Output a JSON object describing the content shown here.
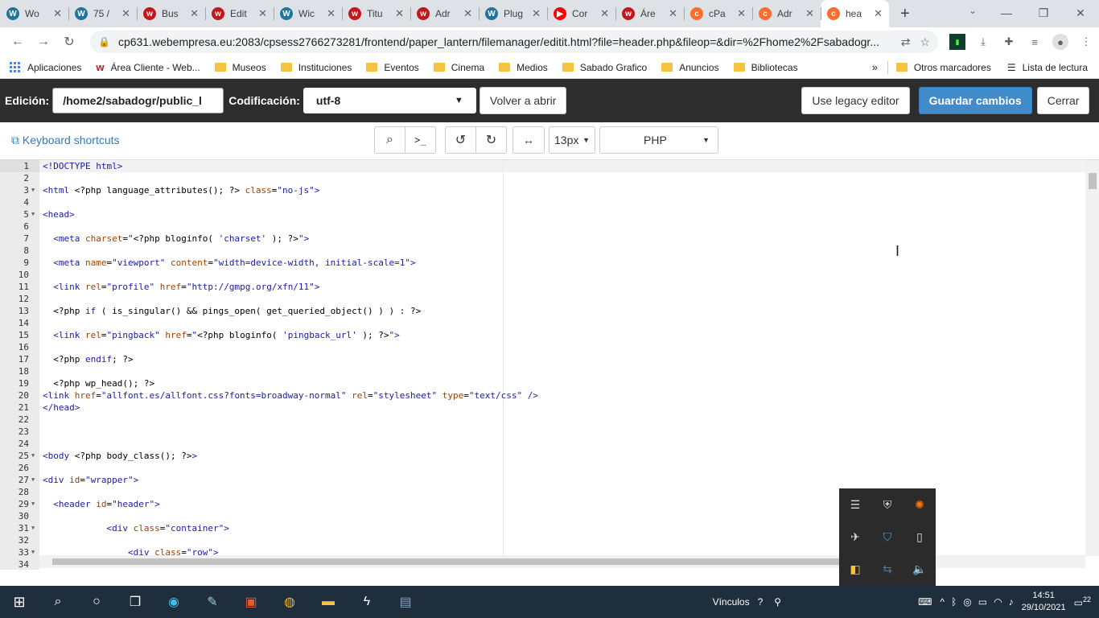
{
  "tabs": [
    {
      "title": "Wo",
      "icon": "wordpress-icon",
      "color": "#21759b"
    },
    {
      "title": "75 /",
      "icon": "wordpress-icon",
      "color": "#21759b"
    },
    {
      "title": "Bus",
      "icon": "webempresa-icon",
      "color": "#c4161c"
    },
    {
      "title": "Edit",
      "icon": "webempresa-icon",
      "color": "#c4161c"
    },
    {
      "title": "Wic",
      "icon": "wordpress-icon",
      "color": "#21759b"
    },
    {
      "title": "Titu",
      "icon": "webempresa-icon",
      "color": "#c4161c"
    },
    {
      "title": "Adr",
      "icon": "webempresa-w-icon",
      "color": "#c4161c"
    },
    {
      "title": "Plug",
      "icon": "wordpress-icon",
      "color": "#21759b"
    },
    {
      "title": "Cor",
      "icon": "youtube-icon",
      "color": "#ff0000"
    },
    {
      "title": "Áre",
      "icon": "webempresa-w-icon",
      "color": "#c4161c"
    },
    {
      "title": "cPa",
      "icon": "cpanel-icon",
      "color": "#ff6c2c"
    },
    {
      "title": "Adr",
      "icon": "cpanel-icon",
      "color": "#ff6c2c"
    },
    {
      "title": "hea",
      "icon": "cpanel-icon",
      "color": "#ff6c2c",
      "active": true
    }
  ],
  "address": {
    "url": "cp631.webempresa.eu:2083/cpsess2766273281/frontend/paper_lantern/filemanager/editit.html?file=header.php&fileop=&dir=%2Fhome2%2Fsabadogr..."
  },
  "bookmarks": {
    "items": [
      {
        "label": "Aplicaciones",
        "type": "apps"
      },
      {
        "label": "Área Cliente - Web...",
        "type": "webempresa"
      },
      {
        "label": "Museos",
        "type": "folder"
      },
      {
        "label": "Instituciones",
        "type": "folder"
      },
      {
        "label": "Eventos",
        "type": "folder"
      },
      {
        "label": "Cinema",
        "type": "folder"
      },
      {
        "label": "Medios",
        "type": "folder"
      },
      {
        "label": "Sabado Grafico",
        "type": "folder"
      },
      {
        "label": "Anuncios",
        "type": "folder"
      },
      {
        "label": "Bibliotecas",
        "type": "folder"
      }
    ],
    "more": "»",
    "other": "Otros marcadores",
    "reading_list": "Lista de lectura"
  },
  "editor_toolbar": {
    "edition_label": "Edición:",
    "path": "/home2/sabadogr/public_l",
    "encoding_label": "Codificación:",
    "encoding": "utf-8",
    "reopen": "Volver a abrir",
    "legacy": "Use legacy editor",
    "save": "Guardar cambios",
    "close": "Cerrar"
  },
  "editor_tools": {
    "keyboard_shortcuts": "Keyboard shortcuts",
    "font_size": "13px",
    "mode": "PHP"
  },
  "code_lines": [
    {
      "n": "1",
      "fold": false,
      "html": "<span class='tag'>&lt;!DOCTYPE html&gt;</span>"
    },
    {
      "n": "2",
      "fold": false,
      "html": ""
    },
    {
      "n": "3",
      "fold": true,
      "html": "<span class='tag'>&lt;html</span> &lt;?php language_attributes(); ?&gt; <span class='attr'>class</span>=<span class='str'>\"no-js\"</span><span class='tag'>&gt;</span>"
    },
    {
      "n": "4",
      "fold": false,
      "html": ""
    },
    {
      "n": "5",
      "fold": true,
      "html": "<span class='tag'>&lt;head&gt;</span>"
    },
    {
      "n": "6",
      "fold": false,
      "html": ""
    },
    {
      "n": "7",
      "fold": false,
      "html": "  <span class='tag'>&lt;meta</span> <span class='attr'>charset</span>=<span class='str'>\"</span>&lt;?php bloginfo( <span class='str'>'charset'</span> ); ?&gt;<span class='str'>\"</span><span class='tag'>&gt;</span>"
    },
    {
      "n": "8",
      "fold": false,
      "html": ""
    },
    {
      "n": "9",
      "fold": false,
      "html": "  <span class='tag'>&lt;meta</span> <span class='attr'>name</span>=<span class='str'>\"viewport\"</span> <span class='attr'>content</span>=<span class='str'>\"width=device-width, initial-scale=1\"</span><span class='tag'>&gt;</span>"
    },
    {
      "n": "10",
      "fold": false,
      "html": ""
    },
    {
      "n": "11",
      "fold": false,
      "html": "  <span class='tag'>&lt;link</span> <span class='attr'>rel</span>=<span class='str'>\"profile\"</span> <span class='attr'>href</span>=<span class='str'>\"http://gmpg.org/xfn/11\"</span><span class='tag'>&gt;</span>"
    },
    {
      "n": "12",
      "fold": false,
      "html": ""
    },
    {
      "n": "13",
      "fold": false,
      "html": "  &lt;?php <span class='tag'>if</span> ( is_singular() &amp;&amp; pings_open( get_queried_object() ) ) : ?&gt;"
    },
    {
      "n": "14",
      "fold": false,
      "html": ""
    },
    {
      "n": "15",
      "fold": false,
      "html": "  <span class='tag'>&lt;link</span> <span class='attr'>rel</span>=<span class='str'>\"pingback\"</span> <span class='attr'>href</span>=<span class='str'>\"</span>&lt;?php bloginfo( <span class='str'>'pingback_url'</span> ); ?&gt;<span class='str'>\"</span><span class='tag'>&gt;</span>"
    },
    {
      "n": "16",
      "fold": false,
      "html": ""
    },
    {
      "n": "17",
      "fold": false,
      "html": "  &lt;?php <span class='tag'>endif</span>; ?&gt;"
    },
    {
      "n": "18",
      "fold": false,
      "html": ""
    },
    {
      "n": "19",
      "fold": false,
      "html": "  &lt;?php wp_head(); ?&gt;"
    },
    {
      "n": "20",
      "fold": false,
      "html": "<span class='tag'>&lt;link</span> <span class='attr'>href</span>=<span class='str'>\"allfont.es/allfont.css?fonts=broadway-normal\"</span> <span class='attr'>rel</span>=<span class='str'>\"stylesheet\"</span> <span class='attr'>type</span>=<span class='str'>\"text/css\"</span> <span class='tag'>/&gt;</span>"
    },
    {
      "n": "21",
      "fold": false,
      "html": "<span class='tag'>&lt;/head&gt;</span>"
    },
    {
      "n": "22",
      "fold": false,
      "html": ""
    },
    {
      "n": "23",
      "fold": false,
      "html": ""
    },
    {
      "n": "24",
      "fold": false,
      "html": ""
    },
    {
      "n": "25",
      "fold": true,
      "html": "<span class='tag'>&lt;body</span> &lt;?php body_class(); ?&gt;<span class='tag'>&gt;</span>"
    },
    {
      "n": "26",
      "fold": false,
      "html": ""
    },
    {
      "n": "27",
      "fold": true,
      "html": "<span class='tag'>&lt;div</span> <span class='attr'>id</span>=<span class='str'>\"wrapper\"</span><span class='tag'>&gt;</span>"
    },
    {
      "n": "28",
      "fold": false,
      "html": ""
    },
    {
      "n": "29",
      "fold": true,
      "html": "  <span class='tag'>&lt;header</span> <span class='attr'>id</span>=<span class='str'>\"header\"</span><span class='tag'>&gt;</span>"
    },
    {
      "n": "30",
      "fold": false,
      "html": ""
    },
    {
      "n": "31",
      "fold": true,
      "html": "            <span class='tag'>&lt;div</span> <span class='attr'>class</span>=<span class='str'>\"container\"</span><span class='tag'>&gt;</span>"
    },
    {
      "n": "32",
      "fold": false,
      "html": ""
    },
    {
      "n": "33",
      "fold": true,
      "html": "                <span class='tag'>&lt;div</span> <span class='attr'>class</span>=<span class='str'>\"row\"</span><span class='tag'>&gt;</span>"
    },
    {
      "n": "34",
      "fold": false,
      "html": ""
    }
  ],
  "tray_flyout": [
    "chat-icon",
    "shield-icon",
    "avast-icon",
    "ninja-icon",
    "defender-icon",
    "usb-icon",
    "bluetooth-app-icon",
    "teamviewer-icon",
    "volume-icon"
  ],
  "taskbar": {
    "links_label": "Vínculos",
    "time": "14:51",
    "date": "29/10/2021",
    "notifications": "22"
  }
}
